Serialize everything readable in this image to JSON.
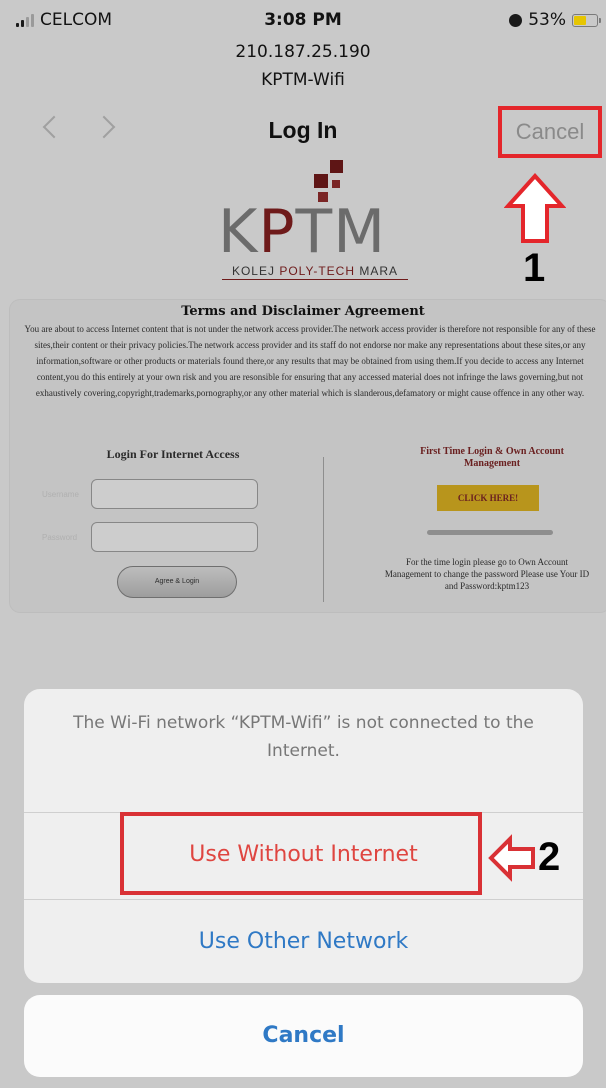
{
  "status_bar": {
    "carrier": "CELCOM",
    "time": "3:08 PM",
    "battery": "53%",
    "battery_level": 0.53
  },
  "header": {
    "ip": "210.187.25.190",
    "ssid": "KPTM-Wifi"
  },
  "nav": {
    "title": "Log In",
    "cancel_label": "Cancel"
  },
  "annotations": {
    "step1": "1",
    "step2": "2",
    "highlight_color": "#e4262b"
  },
  "logo": {
    "letters_left": "K",
    "letter_accent": "P",
    "letters_right": "TM",
    "subtitle_left": "KOLEJ ",
    "subtitle_accent": "POLY-TECH",
    "subtitle_right": " MARA",
    "accent_color": "#6e1a1a"
  },
  "terms": {
    "title": "Terms and Disclaimer Agreement",
    "body": "You are about to access Internet content that is not under the network access provider.The network access provider is therefore not responsible for any of these sites,their content or their privacy policies.The network access provider and its staff do not endorse nor make any representations about these sites,or any information,software or other products or materials found there,or any results that may be obtained from using them.If you decide to access any Internet content,you do this entirely at your own risk and you are resonsible for ensuring that any accessed material does not infringe the laws governing,but not exhaustively covering,copyright,trademarks,pornography,or any other material which is slanderous,defamatory or might cause offence in any other way."
  },
  "login_form": {
    "heading": "Login For Internet Access",
    "username_label": "Username",
    "password_label": "Password",
    "submit_label": "Agree & Login"
  },
  "account": {
    "heading": "First Time Login & Own Account Management",
    "click_label": "CLICK HERE!",
    "note": "For the time login please go to Own Account Management to change the password Please use Your ID and Password:kptm123"
  },
  "action_sheet": {
    "message": "The Wi-Fi network “KPTM-Wifi” is not connected to the Internet.",
    "use_without_internet": "Use Without Internet",
    "use_other_network": "Use Other Network",
    "cancel": "Cancel",
    "destructive_color": "#df4540",
    "default_color": "#2f79c5"
  }
}
